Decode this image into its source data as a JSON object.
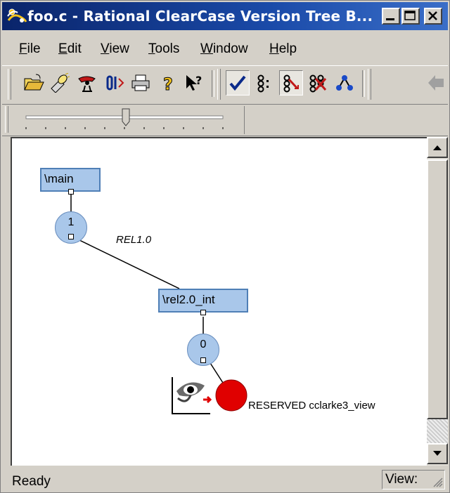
{
  "window": {
    "title": "foo.c - Rational ClearCase Version Tree B...",
    "buttons": {
      "minimize_icon": "minimize-icon",
      "maximize_icon": "maximize-icon",
      "close_icon": "close-icon"
    }
  },
  "menu": {
    "items": [
      {
        "label": "File",
        "accel": "F"
      },
      {
        "label": "Edit",
        "accel": "E"
      },
      {
        "label": "View",
        "accel": "V"
      },
      {
        "label": "Tools",
        "accel": "T"
      },
      {
        "label": "Window",
        "accel": "W"
      },
      {
        "label": "Help",
        "accel": "H"
      }
    ]
  },
  "toolbar": {
    "icons": [
      "open-folder-icon",
      "flashlight-icon",
      "bird-icon",
      "merge-icon",
      "print-icon",
      "help-icon",
      "whats-this-icon",
      "checkmark-icon",
      "versions-list-icon",
      "show-all-icon",
      "hide-versions-icon",
      "tree-icon",
      "back-arrow-icon"
    ],
    "pressed": [
      "checkmark-icon",
      "show-all-icon"
    ]
  },
  "zoom_slider": {
    "position": 0.45
  },
  "tree": {
    "main_branch": "\\main",
    "version_main_1": "1",
    "label_rel": "REL1.0",
    "rel_branch": "\\rel2.0_int",
    "version_rel_0": "0",
    "checkout_text": "RESERVED cclarke3_view",
    "checkout_color": "#e00000",
    "node_color": "#a9c7ea"
  },
  "status": {
    "ready": "Ready",
    "view_label": "View:"
  }
}
